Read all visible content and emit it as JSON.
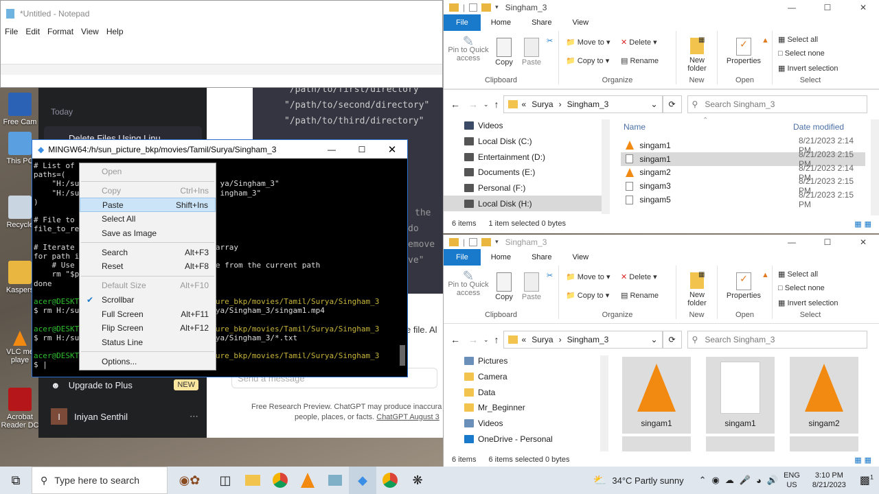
{
  "desktop": {
    "icons": [
      "Free Cam",
      "This PC",
      "Recycle",
      "Kaspers",
      "VLC me\nplaye",
      "Acrobat\nReader DC"
    ]
  },
  "notepad": {
    "title": "*Untitled - Notepad",
    "menu": [
      "File",
      "Edit",
      "Format",
      "View",
      "Help"
    ]
  },
  "chat": {
    "today": "Today",
    "item": "Delete Files Using Linu",
    "code": [
      "\"/path/to/first/directory\"",
      "\"/path/to/second/directory\"",
      "\"/path/to/third/directory\""
    ],
    "upgrade": "Upgrade to Plus",
    "new_badge": "NEW",
    "user": "Iniyan Senthil",
    "user_initial": "I",
    "send": "Send a message",
    "footer1": "Free Research Preview. ChatGPT may produce inaccura",
    "footer2": "people, places, or facts.",
    "footer_link": "ChatGPT August 3",
    "frag1": "the",
    "frag2": "do",
    "frag3": "emove",
    "frag4": "ve\"",
    "frag5": "e file. Al"
  },
  "terminal": {
    "title": "MINGW64:/h/sun_picture_bkp/movies/Tamil/Surya/Singham_3",
    "lines": [
      "# List of",
      "paths=(",
      "    \"H:/su                               ya/Singham_3\"",
      "    \"H:/su                               ingham_3\"",
      ")",
      "",
      "# File to",
      "file_to_re",
      "",
      "# Iterate                               array",
      "for path i",
      "    # Use                               e from the current path",
      "    rm \"$p",
      "done",
      "",
      "acer@DESKT                              ure_bkp/movies/Tamil/Surya/Singham_3",
      "$ rm H:/su                              ya/Singham_3/singam1.mp4",
      "",
      "acer@DESKT                              ure_bkp/movies/Tamil/Surya/Singham_3",
      "$ rm H:/su                              ya/Singham_3/*.txt",
      "",
      "acer@DESKT                              ure_bkp/movies/Tamil/Surya/Singham_3",
      "$ |"
    ]
  },
  "context_menu": [
    {
      "label": "Open",
      "key": "",
      "enabled": false
    },
    {
      "sep": true
    },
    {
      "label": "Copy",
      "key": "Ctrl+Ins",
      "enabled": false
    },
    {
      "label": "Paste",
      "key": "Shift+Ins",
      "enabled": true,
      "selected": true
    },
    {
      "label": "Select All",
      "key": "",
      "enabled": true
    },
    {
      "label": "Save as Image",
      "key": "",
      "enabled": true
    },
    {
      "sep": true
    },
    {
      "label": "Search",
      "key": "Alt+F3",
      "enabled": true
    },
    {
      "label": "Reset",
      "key": "Alt+F8",
      "enabled": true
    },
    {
      "sep": true
    },
    {
      "label": "Default Size",
      "key": "Alt+F10",
      "enabled": false
    },
    {
      "label": "Scrollbar",
      "key": "",
      "enabled": true,
      "checked": true
    },
    {
      "label": "Full Screen",
      "key": "Alt+F11",
      "enabled": true
    },
    {
      "label": "Flip Screen",
      "key": "Alt+F12",
      "enabled": true
    },
    {
      "label": "Status Line",
      "key": "",
      "enabled": true
    },
    {
      "sep": true
    },
    {
      "label": "Options...",
      "key": "",
      "enabled": true
    }
  ],
  "explorer_top": {
    "title": "Singham_3",
    "tabs": [
      "File",
      "Home",
      "Share",
      "View"
    ],
    "ribbon": {
      "pin": "Pin to Quick access",
      "copy": "Copy",
      "paste": "Paste",
      "clipboard": "Clipboard",
      "move_to": "Move to",
      "copy_to": "Copy to",
      "delete": "Delete",
      "rename": "Rename",
      "organize": "Organize",
      "new_folder": "New folder",
      "new": "New",
      "properties": "Properties",
      "open": "Open",
      "select_all": "Select all",
      "select_none": "Select none",
      "invert": "Invert selection",
      "select": "Select"
    },
    "crumbs": [
      "Surya",
      "Singham_3"
    ],
    "search": "Search Singham_3",
    "nav": [
      "Videos",
      "Local Disk (C:)",
      "Entertainment (D:)",
      "Documents (E:)",
      "Personal (F:)",
      "Local Disk (H:)"
    ],
    "col_name": "Name",
    "col_date": "Date modified",
    "files": [
      {
        "name": "singam1",
        "date": "8/21/2023 2:14 PM",
        "icon": "vlc"
      },
      {
        "name": "singam1",
        "date": "8/21/2023 2:15 PM",
        "icon": "txt",
        "selected": true
      },
      {
        "name": "singam2",
        "date": "8/21/2023 2:14 PM",
        "icon": "vlc"
      },
      {
        "name": "singam3",
        "date": "8/21/2023 2:15 PM",
        "icon": "txt"
      },
      {
        "name": "singam5",
        "date": "8/21/2023 2:15 PM",
        "icon": "txt"
      }
    ],
    "status": {
      "count": "6 items",
      "selected": "1 item selected  0 bytes"
    }
  },
  "explorer_bottom": {
    "title": "Singham_3",
    "tabs": [
      "File",
      "Home",
      "Share",
      "View"
    ],
    "crumbs": [
      "Surya",
      "Singham_3"
    ],
    "search": "Search Singham_3",
    "nav": [
      "Pictures",
      "Camera",
      "Data",
      "Mr_Beginner",
      "Videos",
      "OneDrive - Personal"
    ],
    "tiles": [
      "singam1",
      "singam1",
      "singam2"
    ],
    "status": {
      "count": "6 items",
      "selected": "6 items selected  0 bytes"
    }
  },
  "taskbar": {
    "search": "Type here to search",
    "weather": "34°C  Partly sunny",
    "lang": "ENG",
    "region": "US",
    "time": "3:10 PM",
    "date": "8/21/2023",
    "temp_icon_text": "1"
  },
  "colors": {
    "accent": "#1979ca",
    "terminal_green": "#2fbf2f",
    "terminal_yellow": "#c8b43a",
    "vlc_orange": "#f28a12"
  }
}
